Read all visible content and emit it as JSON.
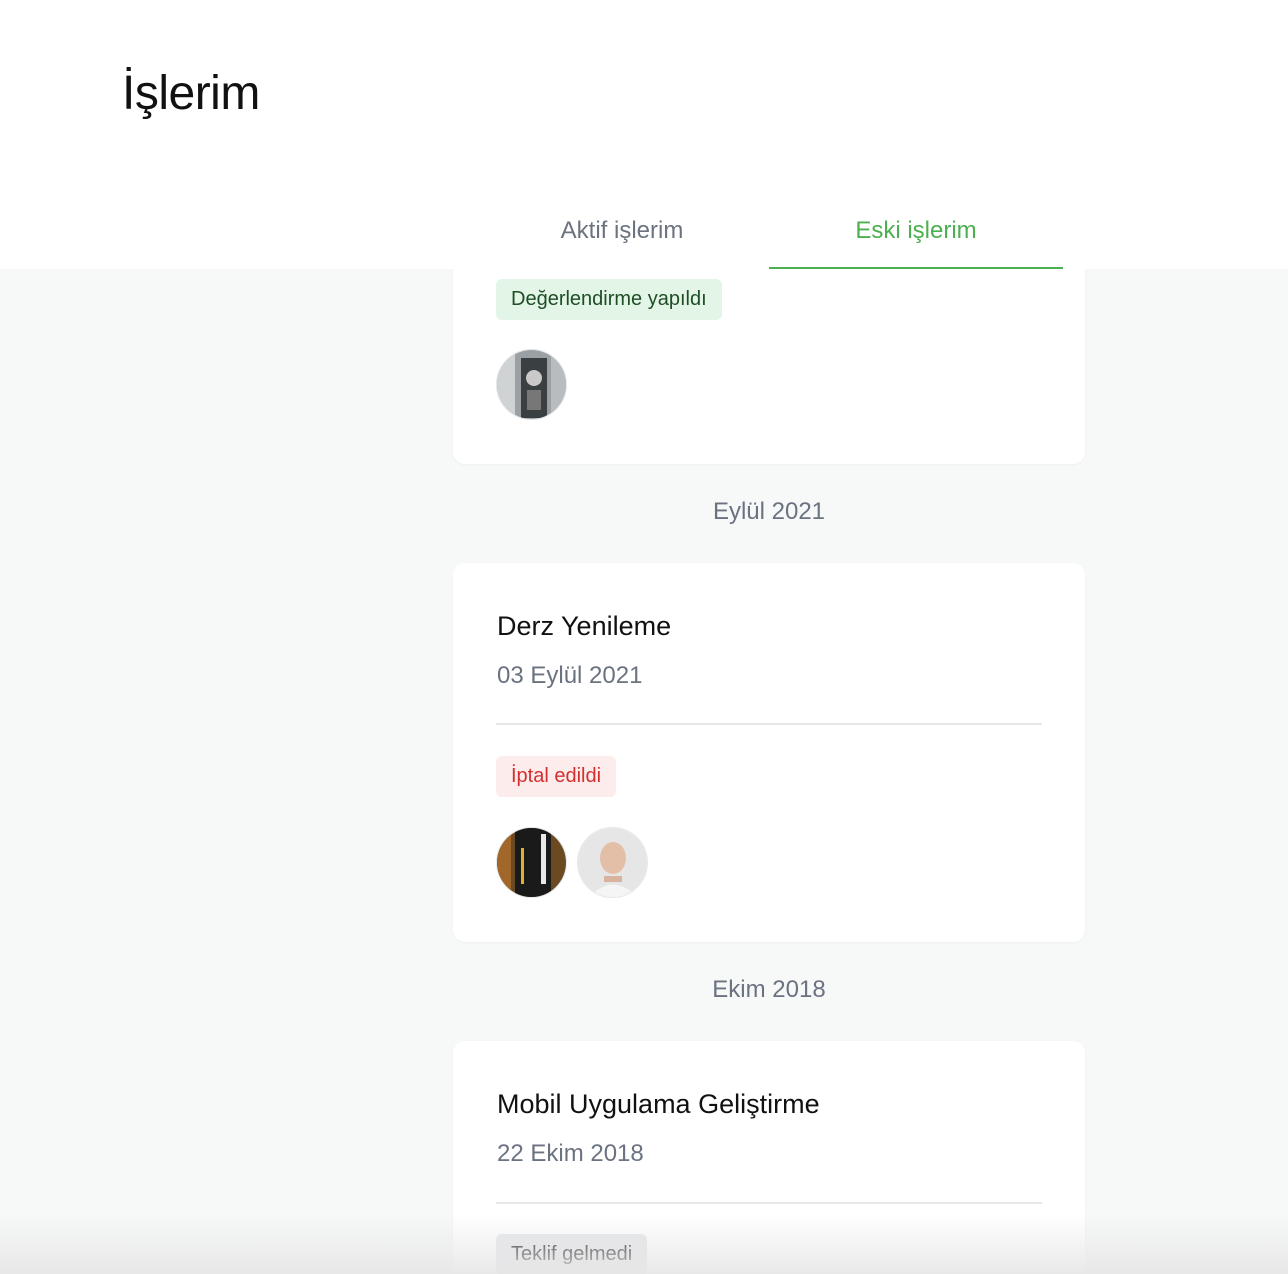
{
  "page": {
    "title": "İşlerim"
  },
  "tabs": [
    {
      "label": "Aktif işlerim",
      "active": false
    },
    {
      "label": "Eski işlerim",
      "active": true
    }
  ],
  "cards": [
    {
      "badge": "Değerlendirme yapıldı",
      "badge_type": "green",
      "avatars": [
        "avatar-photo-device"
      ]
    },
    {
      "month": "Eylül 2021",
      "title": "Derz Yenileme",
      "date": "03 Eylül 2021",
      "badge": "İptal edildi",
      "badge_type": "red",
      "avatars": [
        "avatar-photo-business-card",
        "avatar-photo-person"
      ]
    },
    {
      "month": "Ekim 2018",
      "title": "Mobil Uygulama Geliştirme",
      "date": "22 Ekim 2018",
      "badge": "Teklif gelmedi",
      "badge_type": "gray",
      "avatars": []
    }
  ],
  "colors": {
    "accent": "#4caf50",
    "cancel": "#d32f2f",
    "background": "#f7f8f8"
  }
}
